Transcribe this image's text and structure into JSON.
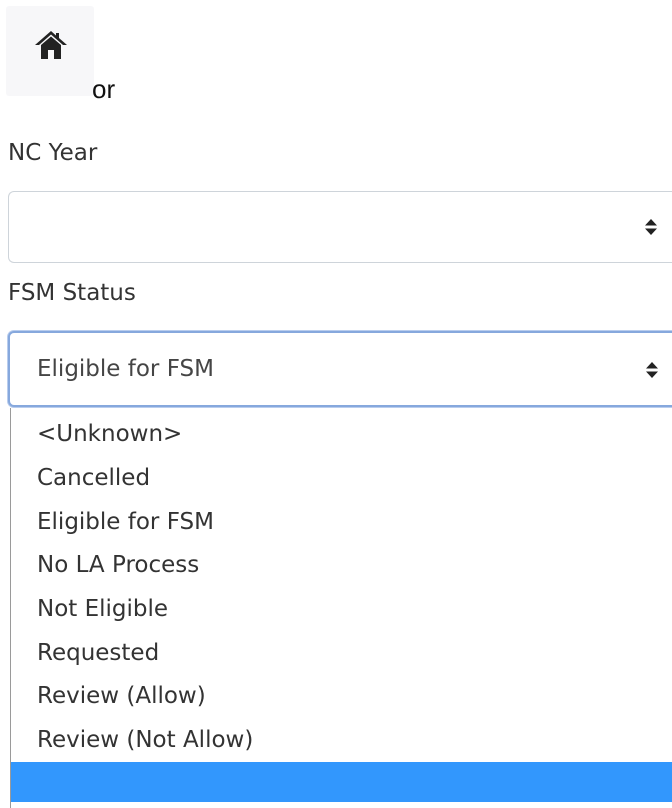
{
  "home": {
    "icon": "home-icon",
    "icon_color": "#222222"
  },
  "separator_text": "or",
  "nc_year": {
    "label": "NC Year",
    "value": "",
    "arrow_icon": "select-arrows-icon"
  },
  "fsm_status": {
    "label": "FSM Status",
    "value": "Eligible for FSM",
    "arrow_icon": "select-arrows-icon",
    "focus_color": "#86a8dd",
    "options": [
      "<Unknown>",
      "Cancelled",
      "Eligible for FSM",
      "No LA Process",
      "Not Eligible",
      "Requested",
      "Review (Allow)",
      "Review (Not Allow)",
      ""
    ],
    "highlight_color": "#3297fd"
  }
}
